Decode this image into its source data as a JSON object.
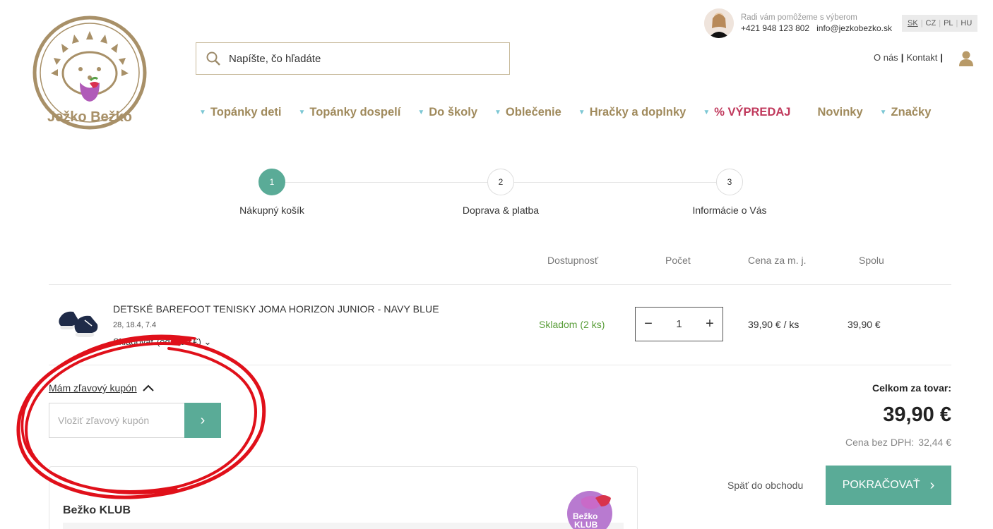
{
  "header": {
    "logo_text": "Ježko Bežko",
    "search": {
      "placeholder": "Napíšte, čo hľadáte",
      "icon": "search-icon"
    },
    "contact": {
      "help_text": "Radi vám pomôžeme s výberom",
      "phone": "+421 948 123 802",
      "email": "info@jezkobezko.sk"
    },
    "languages": [
      "SK",
      "CZ",
      "PL",
      "HU"
    ],
    "active_language": "SK",
    "links": {
      "about": "O nás",
      "contact": "Kontakt",
      "bar": "|"
    },
    "user_icon": "user-icon"
  },
  "nav": [
    {
      "label": "Topánky deti",
      "dropdown": true
    },
    {
      "label": "Topánky dospelí",
      "dropdown": true
    },
    {
      "label": "Do školy",
      "dropdown": true
    },
    {
      "label": "Oblečenie",
      "dropdown": true
    },
    {
      "label": "Hračky a doplnky",
      "dropdown": true
    },
    {
      "label": "% VÝPREDAJ",
      "dropdown": true
    },
    {
      "label": "Novinky",
      "dropdown": false
    },
    {
      "label": "Značky",
      "dropdown": true
    }
  ],
  "steps": [
    {
      "num": "1",
      "label": "Nákupný košík",
      "active": true
    },
    {
      "num": "2",
      "label": "Doprava & platba",
      "active": false
    },
    {
      "num": "3",
      "label": "Informácie o Vás",
      "active": false
    }
  ],
  "cart": {
    "headers": {
      "availability": "Dostupnosť",
      "qty": "Počet",
      "unit_price": "Cena za m. j.",
      "total": "Spolu"
    },
    "items": [
      {
        "name": "DETSKÉ BAREFOOT TENISKY JOMA HORIZON JUNIOR - NAVY BLUE",
        "variant": "28, 18.4, 7.4",
        "service": "Skladovať (od 6,90 €)",
        "availability": "Skladom (2 ks)",
        "qty": "1",
        "unit_price": "39,90 € / ks",
        "total": "39,90 €"
      }
    ]
  },
  "coupon": {
    "toggle_label": "Mám zľavový kupón",
    "placeholder": "Vložiť zľavový kupón"
  },
  "totals": {
    "label": "Celkom za tovar:",
    "value": "39,90 €",
    "net_label": "Cena bez DPH:",
    "net_value": "32,44 €"
  },
  "actions": {
    "back": "Späť do obchodu",
    "continue": "POKRAČOVAŤ"
  },
  "klub": {
    "title": "Bežko KLUB",
    "badge_line1": "Bežko",
    "badge_line2": "KLUB"
  },
  "colors": {
    "accent": "#5aab97",
    "nav_text": "#a08a5c",
    "sale": "#c0395c",
    "stock": "#5a9e3a",
    "annotation": "#e0101a"
  }
}
